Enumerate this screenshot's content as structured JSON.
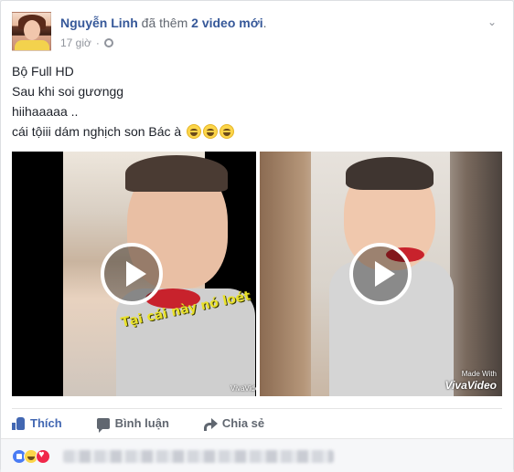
{
  "post": {
    "author": "Nguyễn Linh",
    "action_text": "đã thêm",
    "count_text": "2 video mới",
    "period": ".",
    "time": "17 giờ",
    "separator": "·",
    "lines": [
      "Bộ Full HD",
      "Sau khi soi gươngg",
      "hiihaaaaa ..",
      "cái tộiii dám nghịch son Bác à"
    ]
  },
  "videos": [
    {
      "caption": "Tại cái này nó loét",
      "watermark": "VivaVideo"
    },
    {
      "watermark_small": "Made With",
      "watermark": "VivaVideo"
    }
  ],
  "actions": {
    "like": "Thích",
    "comment": "Bình luận",
    "share": "Chia sẻ"
  },
  "icons": {
    "privacy": "globe-icon",
    "menu": "chevron-down-icon",
    "like": "thumbs-up-icon",
    "comment": "comment-icon",
    "share": "share-arrow-icon"
  },
  "colors": {
    "link": "#365899",
    "like_blue": "#4267b2",
    "muted": "#90949c"
  }
}
